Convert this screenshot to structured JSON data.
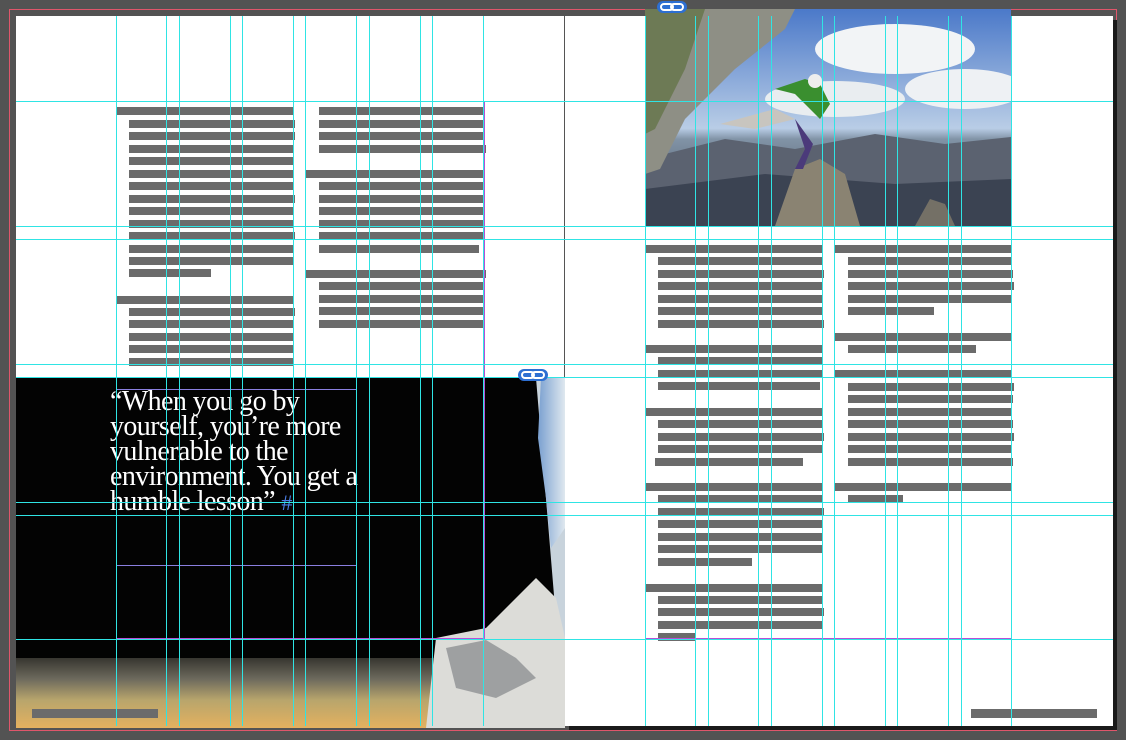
{
  "document": {
    "quote_text": "“When you go by yourself, you’re more vulnerable to the environment. You get a humble lesson”",
    "quote_mark": "#"
  },
  "icons": {
    "link_left": "link-icon",
    "link_right": "link-icon"
  },
  "colors": {
    "pasteboard": "#535353",
    "page": "#ffffff",
    "guide": "#2fe4e4",
    "margin": "#b84fd6",
    "bleed": "#e0566b",
    "greek_text": "#6b6b6b",
    "marker": "#4a7ee6"
  }
}
